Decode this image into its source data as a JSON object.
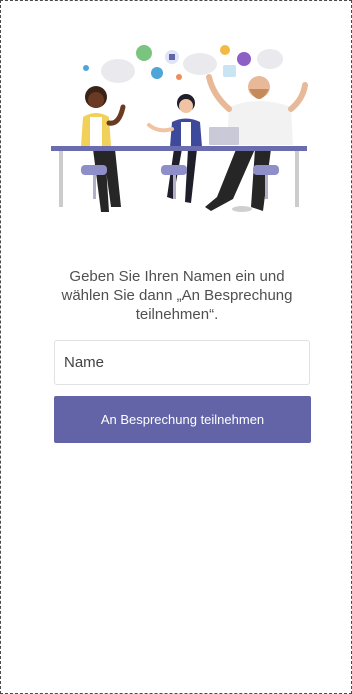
{
  "prompt": {
    "line1": "Geben Sie Ihren Namen ein und",
    "line2": "wählen Sie dann „An Besprechung",
    "line3": "teilnehmen“."
  },
  "name_field": {
    "placeholder": "Name",
    "value": ""
  },
  "join_button": {
    "label": "An Besprechung teilnehmen"
  },
  "colors": {
    "accent": "#6264a7",
    "table": "#6b6bb0",
    "text": "#505050"
  }
}
